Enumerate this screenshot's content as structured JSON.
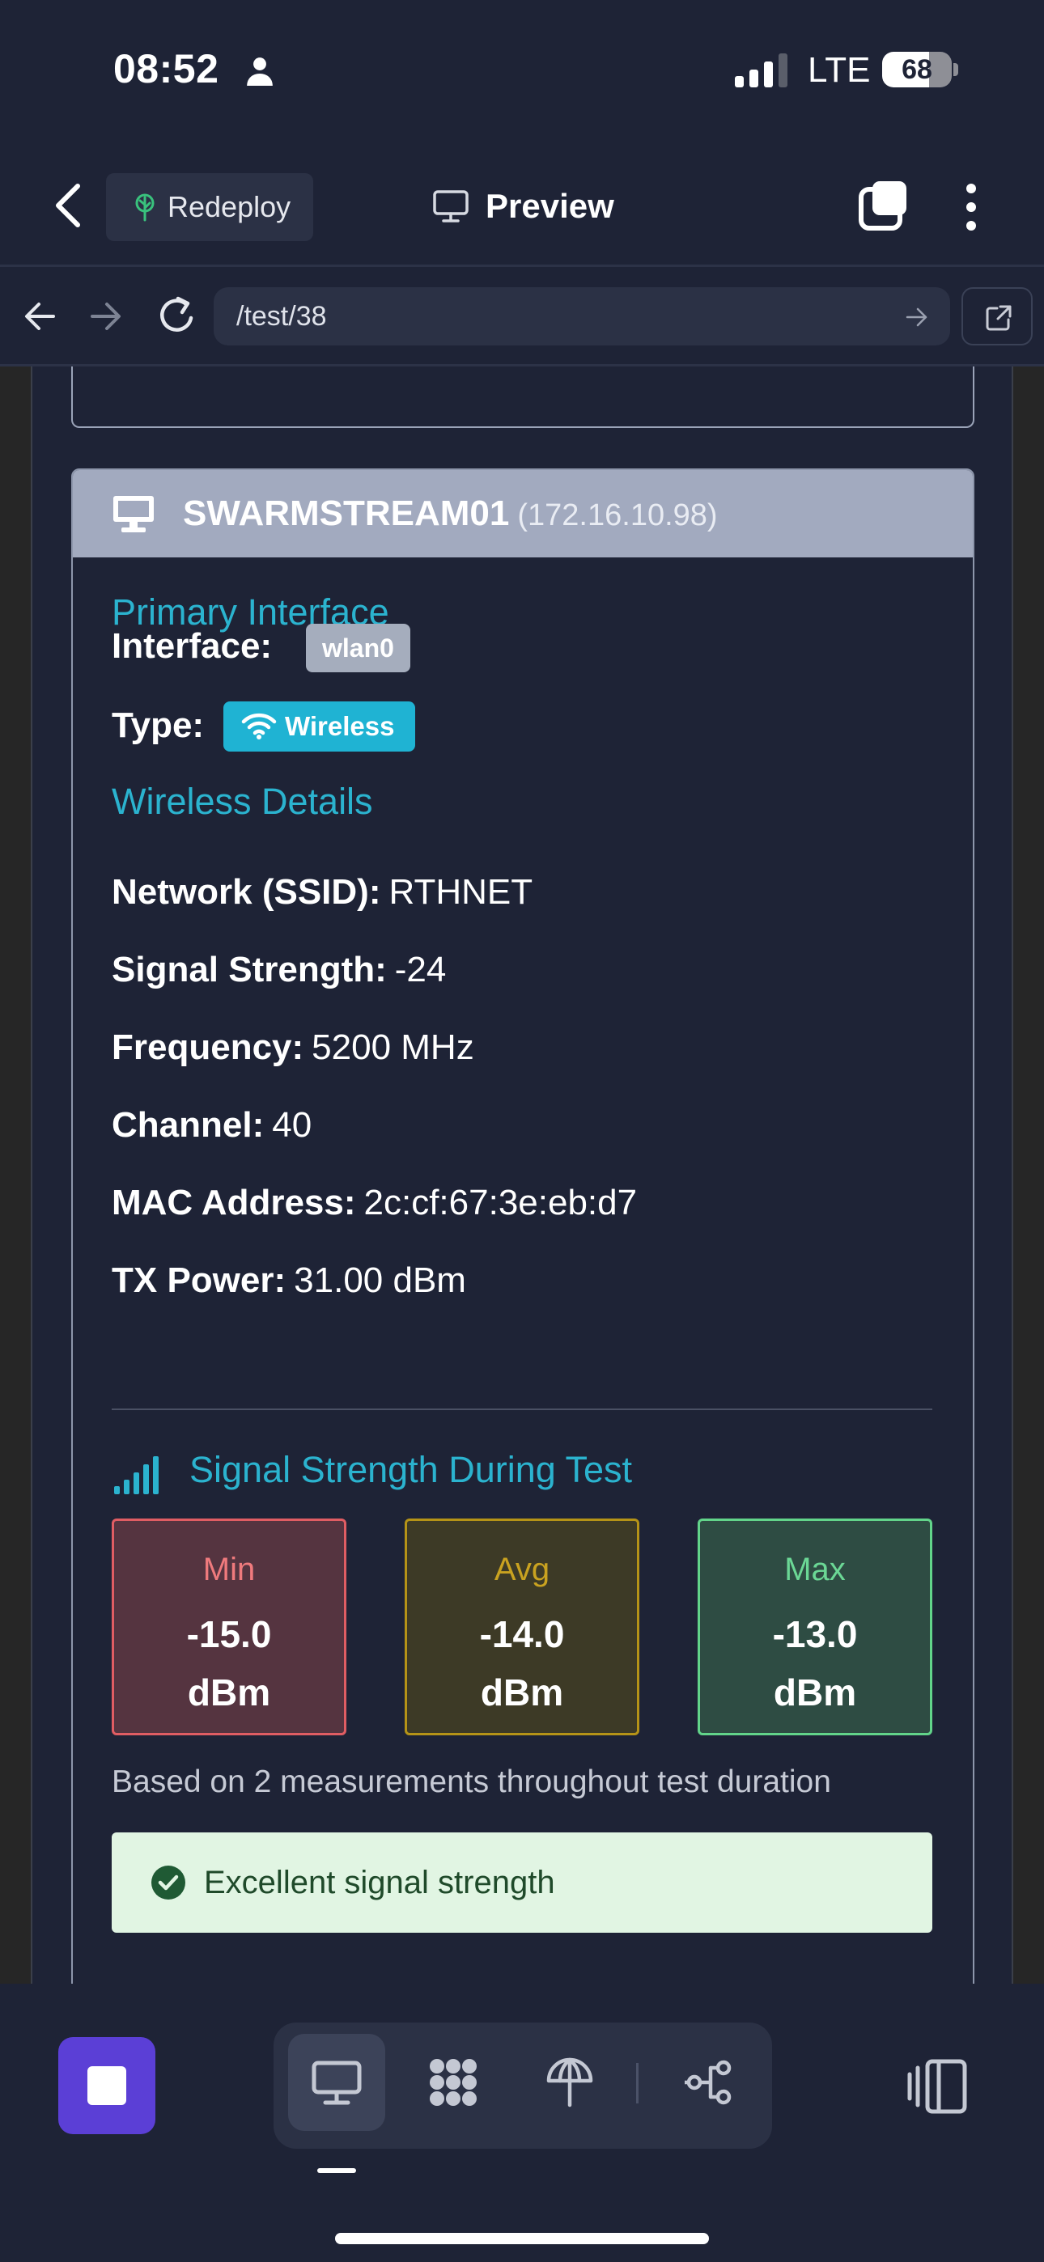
{
  "status_bar": {
    "time": "08:52",
    "network": "LTE",
    "battery_percent": 68,
    "battery_label": "68",
    "signal_bars_active": 3,
    "signal_bars_total": 4
  },
  "header": {
    "back_icon": "chevron-left-icon",
    "redeploy_label": "Redeploy",
    "redeploy_icon": "tree-icon",
    "preview_label": "Preview",
    "preview_icon": "monitor-icon",
    "tabs_icon": "tabs-icon",
    "menu_icon": "more-vertical-icon"
  },
  "url_bar": {
    "url": "/test/38",
    "back_icon": "arrow-left-icon",
    "forward_icon": "arrow-right-icon",
    "reload_icon": "reload-icon",
    "go_icon": "arrow-right-icon",
    "open_external_icon": "external-link-icon"
  },
  "device_card": {
    "icon": "monitor-icon",
    "hostname": "SWARMSTREAM01",
    "ip": "(172.16.10.98)",
    "primary_interface_title": "Primary Interface",
    "interface_label": "Interface:",
    "interface_value": "wlan0",
    "type_label": "Type:",
    "type_value": "Wireless",
    "type_icon": "wifi-icon",
    "wireless_details_title": "Wireless Details",
    "details": [
      {
        "label": "Network (SSID):",
        "value": "RTHNET"
      },
      {
        "label": "Signal Strength:",
        "value": "-24"
      },
      {
        "label": "Frequency:",
        "value": "5200 MHz"
      },
      {
        "label": "Channel:",
        "value": "40"
      },
      {
        "label": "MAC Address:",
        "value": "2c:cf:67:3e:eb:d7"
      },
      {
        "label": "TX Power:",
        "value": "31.00 dBm"
      }
    ],
    "signal_section": {
      "title": "Signal Strength During Test",
      "icon": "signal-bars-icon",
      "min_label": "Min",
      "min_value": "-15.0",
      "avg_label": "Avg",
      "avg_value": "-14.0",
      "max_label": "Max",
      "max_value": "-13.0",
      "unit": "dBm",
      "note": "Based on 2 measurements throughout test duration",
      "status_text": "Excellent signal strength",
      "status_icon": "check-circle-icon"
    }
  },
  "bottom_bar": {
    "stop_icon": "stop-icon",
    "buttons": [
      {
        "name": "desktop-view",
        "icon": "monitor-icon",
        "active": true
      },
      {
        "name": "apps",
        "icon": "apps-grid-icon",
        "active": false
      },
      {
        "name": "deploy",
        "icon": "tree-icon",
        "active": false
      },
      {
        "name": "share",
        "icon": "share-nodes-icon",
        "active": false
      }
    ],
    "side_panel_icon": "side-panel-icon"
  },
  "colors": {
    "background": "#1e2336",
    "accent": "#2bb3cf",
    "min": "#e05d63",
    "avg": "#b59317",
    "max": "#62d48a",
    "success_bg": "#e1f5e3",
    "primary": "#5b3fd6"
  }
}
